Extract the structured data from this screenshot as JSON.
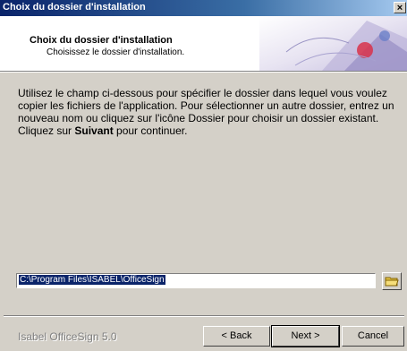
{
  "window": {
    "title": "Choix du dossier d'installation",
    "close_glyph": "×"
  },
  "header": {
    "title": "Choix du dossier d'installation",
    "subtitle": "Choisissez le dossier d'installation."
  },
  "description": {
    "text_before": "Utilisez le champ ci-dessous pour spécifier le dossier dans lequel vous voulez copier les fichiers de l'application. Pour sélectionner un autre dossier, entrez un nouveau nom ou cliquez sur l'icône Dossier pour choisir un dossier existant. Cliquez sur ",
    "bold": "Suivant",
    "text_after": " pour continuer."
  },
  "path": {
    "value": "C:\\Program Files\\ISABEL\\OfficeSign"
  },
  "footer": {
    "brand": "Isabel OfficeSign 5.0",
    "back_label": "< Back",
    "next_label": "Next >",
    "cancel_label": "Cancel"
  },
  "colors": {
    "titlebar": "#0a246a",
    "face": "#d4d0c8",
    "selection": "#0a246a"
  },
  "icons": {
    "folder": "folder-icon",
    "close": "close-icon"
  }
}
